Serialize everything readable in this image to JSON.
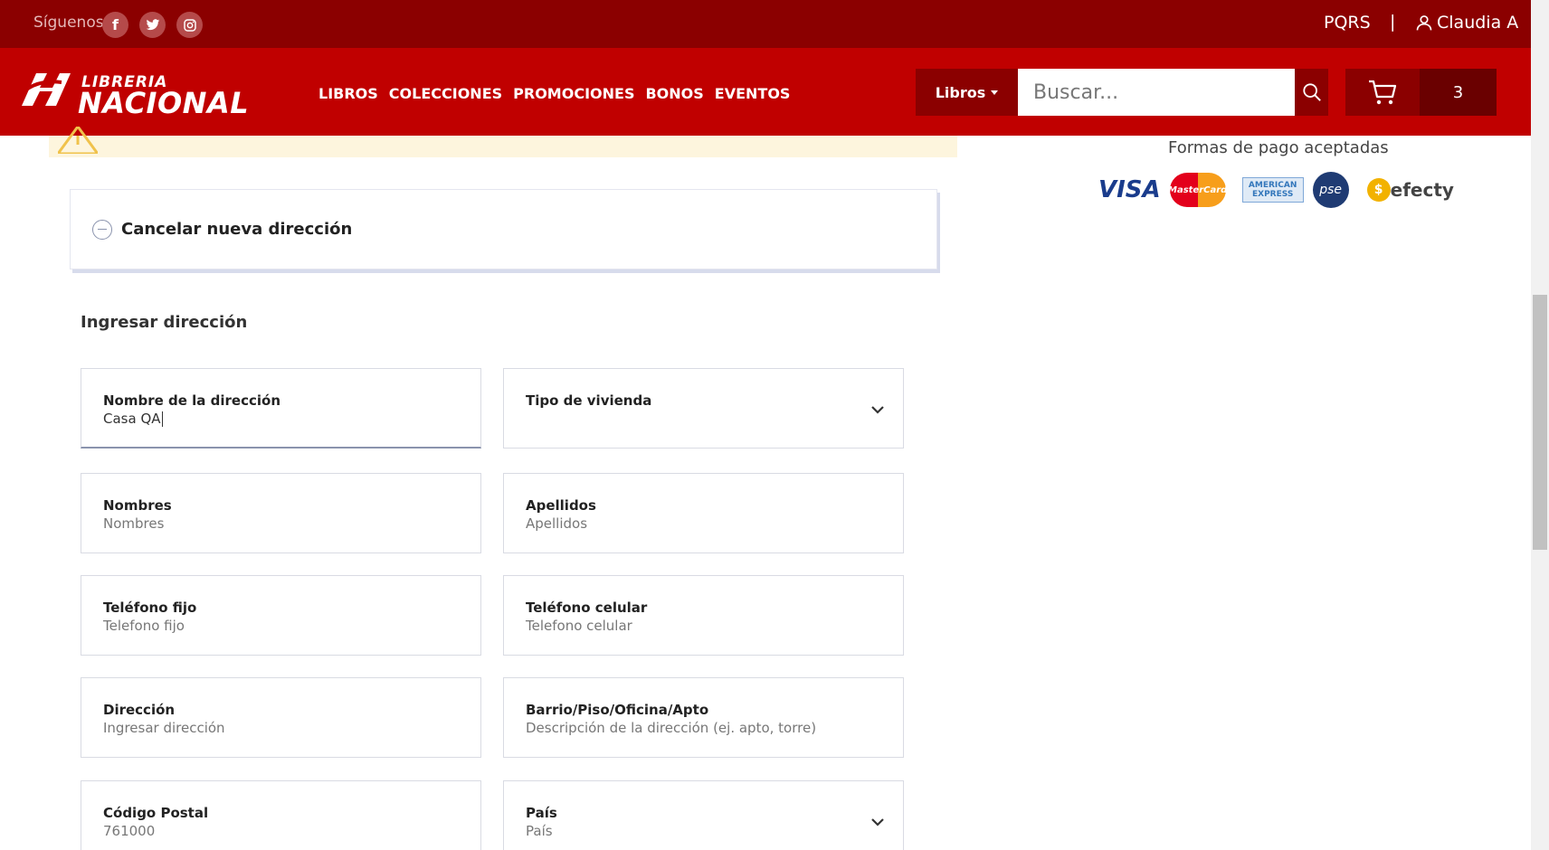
{
  "topbar": {
    "follow_label": "Síguenos",
    "social": [
      {
        "icon": "facebook-icon",
        "glyph": "f"
      },
      {
        "icon": "twitter-icon",
        "glyph": "t"
      },
      {
        "icon": "instagram-icon",
        "glyph": "◎"
      }
    ],
    "pqrs_label": "PQRS",
    "separator": "|",
    "user_name": "Claudia A"
  },
  "header": {
    "logo_top": "LIBRERIA",
    "logo_bottom": "NACIONAL",
    "nav": [
      "LIBROS",
      "COLECCIONES",
      "PROMOCIONES",
      "BONOS",
      "EVENTOS"
    ],
    "category_select": "Libros",
    "search_placeholder": "Buscar...",
    "cart_count": "3"
  },
  "payments": {
    "title": "Formas de pago aceptadas",
    "visa": "VISA",
    "mastercard": "MasterCard",
    "amex_top": "AMERICAN",
    "amex_bottom": "EXPRESS",
    "pse": "pse",
    "efecty": "efecty"
  },
  "address": {
    "cancel_label": "Cancelar nueva dirección",
    "section_title": "Ingresar dirección",
    "fields": [
      {
        "label": "Nombre de la dirección",
        "value": "Casa QA",
        "placeholder": ""
      },
      {
        "label": "Tipo de vivienda",
        "value": "",
        "placeholder": ""
      },
      {
        "label": "Nombres",
        "value": "",
        "placeholder": "Nombres"
      },
      {
        "label": "Apellidos",
        "value": "",
        "placeholder": "Apellidos"
      },
      {
        "label": "Teléfono fijo",
        "value": "",
        "placeholder": "Telefono fijo"
      },
      {
        "label": "Teléfono celular",
        "value": "",
        "placeholder": "Telefono celular"
      },
      {
        "label": "Dirección",
        "value": "",
        "placeholder": "Ingresar dirección"
      },
      {
        "label": "Barrio/Piso/Oficina/Apto",
        "value": "",
        "placeholder": "Descripción de la dirección (ej. apto, torre)"
      },
      {
        "label": "Código Postal",
        "value": "761000",
        "placeholder": ""
      },
      {
        "label": "País",
        "value": "",
        "placeholder": "País"
      }
    ]
  },
  "colors": {
    "topbar": "#8b0000",
    "header": "#c00000",
    "alert_bg": "#fdf5dd"
  }
}
